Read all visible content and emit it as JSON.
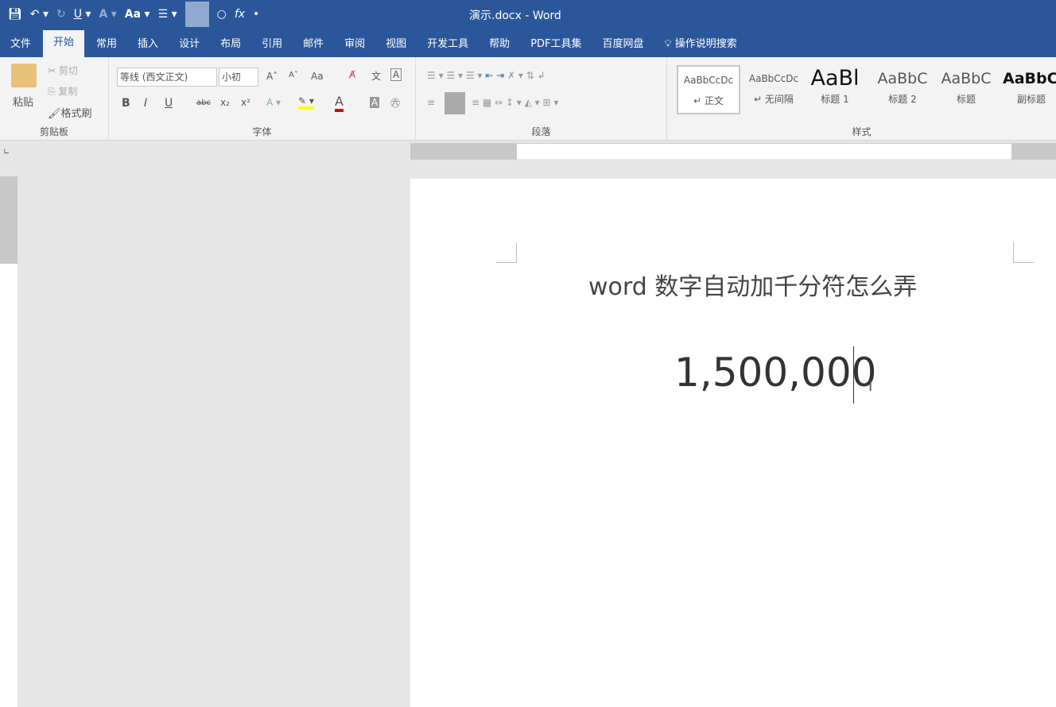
{
  "window": {
    "title": "演示.docx  -  Word"
  },
  "qat": [
    "save-icon",
    "undo-icon",
    "redo-icon",
    "underline-icon",
    "text-effect-icon",
    "change-case-icon",
    "bullets-icon",
    "shape-icon",
    "circle-icon",
    "formula-icon",
    "customize-icon"
  ],
  "qat_labels": {
    "underline": "U",
    "effect": "A",
    "case": "Aa",
    "formula": "fx"
  },
  "tabs": [
    "文件",
    "开始",
    "常用",
    "插入",
    "设计",
    "布局",
    "引用",
    "邮件",
    "审阅",
    "视图",
    "开发工具",
    "帮助",
    "PDF工具集",
    "百度网盘",
    "操作说明搜索"
  ],
  "active_tab": "开始",
  "clipboard": {
    "paste": "粘贴",
    "cut": "剪切",
    "copy": "复制",
    "format_painter": "格式刷",
    "label": "剪贴板"
  },
  "font": {
    "name": "等线 (西文正文)",
    "size": "小初",
    "label": "字体",
    "bold": "B",
    "italic": "I",
    "underline": "U",
    "strike": "abc",
    "sub": "x₂",
    "sup": "x²",
    "case": "Aa",
    "highlight_color": "#ffff00",
    "font_color": "#e00000"
  },
  "paragraph": {
    "label": "段落"
  },
  "styles": {
    "label": "样式",
    "items": [
      {
        "preview": "AaBbCcDc",
        "name": "↵ 正文"
      },
      {
        "preview": "AaBbCcDc",
        "name": "↵ 无间隔"
      },
      {
        "preview": "AaBl",
        "name": "标题 1"
      },
      {
        "preview": "AaBbC",
        "name": "标题 2"
      },
      {
        "preview": "AaBbC",
        "name": "标题"
      },
      {
        "preview": "AaBbC",
        "name": "副标题"
      }
    ]
  },
  "document": {
    "title": "word 数字自动加千分符怎么弄",
    "number": "1,500,000"
  },
  "colors": {
    "brand": "#2b579a",
    "ribbon": "#f3f3f3",
    "canvas": "#e6e6e6"
  }
}
